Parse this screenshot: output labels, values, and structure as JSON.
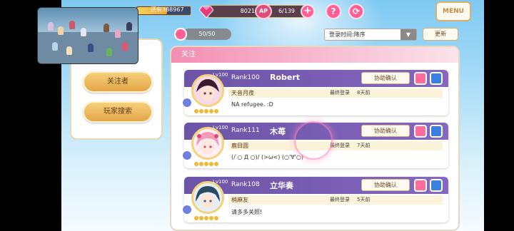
{
  "topbar": {
    "exp_text": "还有388967",
    "exp_progress": 0.55,
    "gems": "8021",
    "ap_label": "AP",
    "ap": "6/139",
    "help_icon": "question-icon",
    "gift_icon": "refresh-icon",
    "menu_label": "MENU"
  },
  "left_menu": {
    "following_label": "关注者",
    "search_label": "玩家搜索"
  },
  "list_header": {
    "count": "50/50",
    "sort_value": "登录时间:降序",
    "refresh_label": "更新",
    "section_title": "关注"
  },
  "friends": [
    {
      "lv_prefix": "Lv",
      "lv": "100",
      "rank": "Rank100",
      "name": "Robert",
      "help_label": "协助确认",
      "leader": "天音月夜",
      "login_label": "最终登录",
      "login_time": "8天前",
      "comment": "NA  refugee.  :D"
    },
    {
      "lv_prefix": "Lv",
      "lv": "100",
      "rank": "Rank111",
      "name": "木苺",
      "help_label": "协助确认",
      "leader": "鹿目圆",
      "login_label": "最终登录",
      "login_time": "7天前",
      "comment": "(/ ○ Д ○)/  (>ω<)  (○'∀'○)"
    },
    {
      "lv_prefix": "Lv",
      "lv": "100",
      "rank": "Rank108",
      "name": "立华奏",
      "help_label": "协助确认",
      "leader": "梢麻友",
      "login_label": "最终登录",
      "login_time": "5天前",
      "comment": "请多多关照!"
    }
  ],
  "colors": {
    "card_header": "#7a5fb6",
    "accent_pink": "#ff5f95",
    "gold": "#e8b04f"
  }
}
